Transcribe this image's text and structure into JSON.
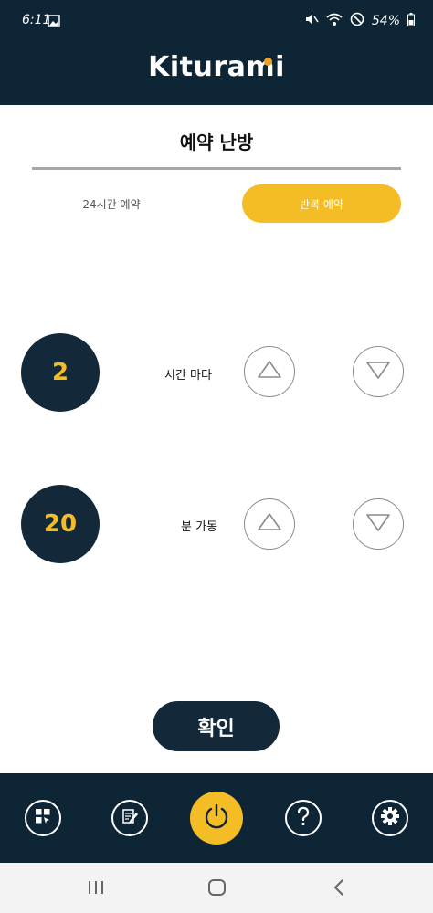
{
  "status_bar": {
    "time": "6:11",
    "battery": "54%"
  },
  "header": {
    "brand": "Kiturami"
  },
  "page": {
    "title": "예약 난방"
  },
  "tabs": [
    {
      "label": "24시간 예약",
      "active": false
    },
    {
      "label": "반복 예약",
      "active": true
    }
  ],
  "rows": [
    {
      "value": "2",
      "label": "시간 마다"
    },
    {
      "value": "20",
      "label": "분 가동"
    }
  ],
  "confirm_label": "확인",
  "colors": {
    "navy": "#0e2536",
    "accent_yellow": "#f5bd25",
    "brand_dot": "#f0a024"
  },
  "bottom_nav": {
    "icons": [
      "grid-menu-icon",
      "edit-note-icon",
      "power-icon",
      "help-icon",
      "settings-icon"
    ]
  },
  "system_nav": {
    "icons": [
      "recent-apps-icon",
      "home-icon",
      "back-icon"
    ]
  }
}
